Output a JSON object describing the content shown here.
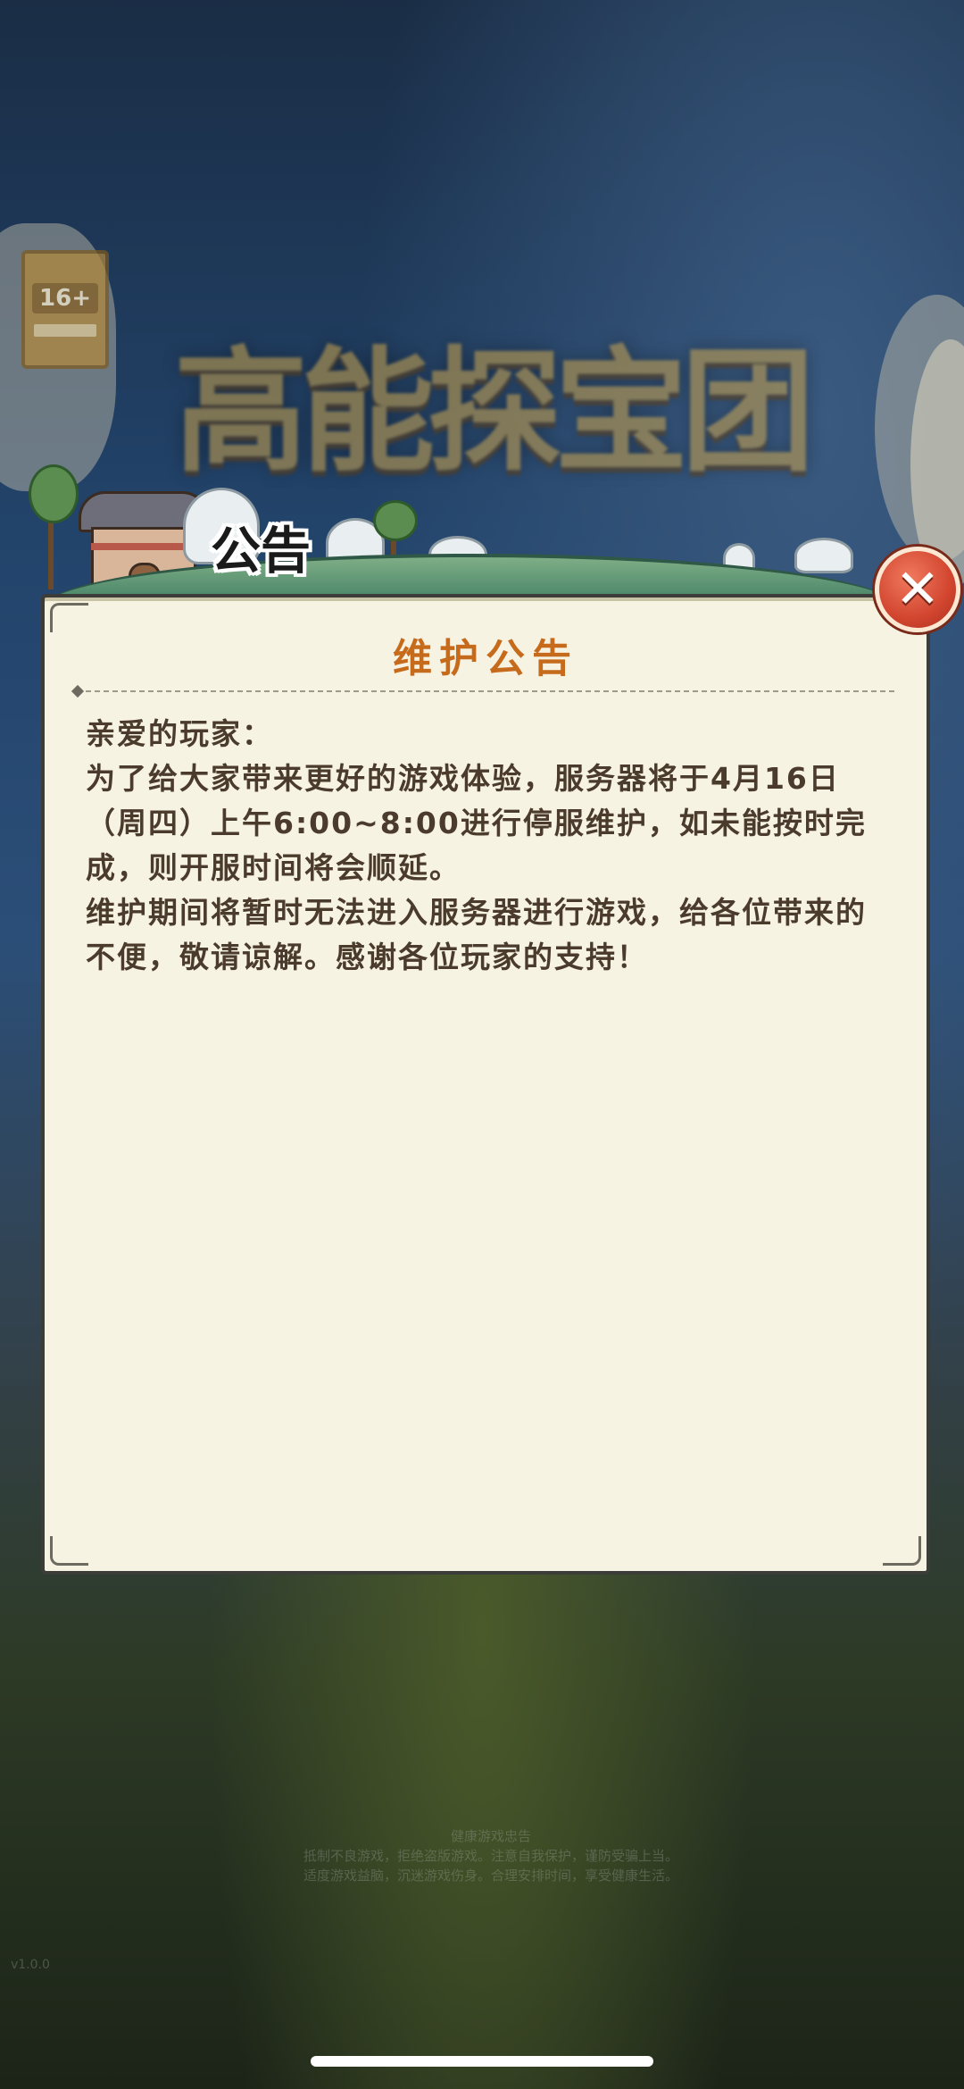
{
  "game": {
    "logo_text": "高能探宝团",
    "age_rating": "16+",
    "legal_text": [
      "健康游戏忠告",
      "抵制不良游戏，拒绝盗版游戏。注意自我保护，谨防受骗上当。",
      "适度游戏益脑，沉迷游戏伤身。合理安排时间，享受健康生活。"
    ],
    "version_text": [
      "v1.0.0"
    ]
  },
  "header": {
    "title": "公告"
  },
  "notice": {
    "title": "维护公告",
    "paragraphs": [
      "亲爱的玩家：",
      "为了给大家带来更好的游戏体验，服务器将于4月16日（周四）上午6:00~8:00进行停服维护，如未能按时完成，则开服时间将会顺延。",
      "维护期间将暂时无法进入服务器进行游戏，给各位带来的不便，敬请谅解。感谢各位玩家的支持！"
    ]
  },
  "close_button": {
    "icon": "close-icon",
    "glyph": "✕"
  },
  "colors": {
    "panel_bg": "#f7f3e2",
    "title_orange": "#c66a1c",
    "body_text": "#4b3b2c",
    "close_red": "#d2452f"
  }
}
